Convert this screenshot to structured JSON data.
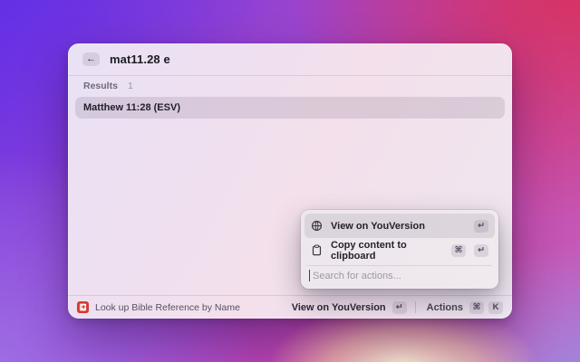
{
  "window": {
    "header": {
      "back_icon": "←",
      "query": "mat11.28 e"
    },
    "results_section": {
      "label": "Results",
      "count": "1"
    },
    "results": [
      {
        "title": "Matthew 11:28 (ESV)",
        "selected": true
      }
    ],
    "status_bar": {
      "app_icon": "bible-app-icon",
      "command_name": "Look up Bible Reference by Name",
      "primary_action": {
        "label": "View on YouVersion",
        "keys": [
          "↵"
        ]
      },
      "actions_button": {
        "label": "Actions",
        "keys": [
          "⌘",
          "K"
        ]
      }
    }
  },
  "actions_panel": {
    "items": [
      {
        "icon": "globe-icon",
        "label": "View on YouVersion",
        "keys": [
          "↵"
        ],
        "selected": true
      },
      {
        "icon": "clipboard-icon",
        "label": "Copy content to clipboard",
        "keys": [
          "⌘",
          "↵"
        ],
        "selected": false
      }
    ],
    "search_placeholder": "Search for actions..."
  },
  "colors": {
    "app_icon_red": "#d33a31",
    "background_violet": "#6230e4",
    "background_crimson": "#dc2e53",
    "background_purple": "#a278e6",
    "glow_cream": "#f7e3c2"
  }
}
